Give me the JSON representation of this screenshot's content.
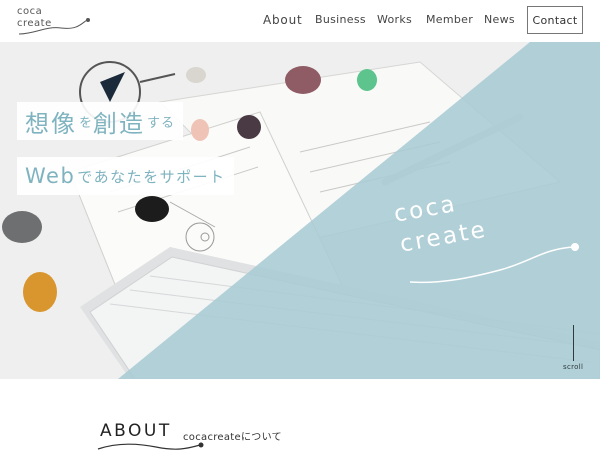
{
  "header": {
    "logo_line1": "coca",
    "logo_line2": "create",
    "nav": {
      "about": "About",
      "business": "Business",
      "works": "Works",
      "member": "Member",
      "news": "News"
    },
    "contact_label": "Contact"
  },
  "hero": {
    "catch_line1_big": "想像",
    "catch_line1_small_a": "を",
    "catch_line1_big_b": "創造",
    "catch_line1_small_b": "する",
    "catch_line2_web": "Web",
    "catch_line2_rest": "であなたをサポート",
    "brand_line1": "coca",
    "brand_line2": "create",
    "scroll_label": "scroll",
    "overlay_color": "#a9cbd4",
    "accent_color": "#7fb3bf"
  },
  "about": {
    "title": "ABOUT",
    "subtitle": "cocacreateについて"
  }
}
